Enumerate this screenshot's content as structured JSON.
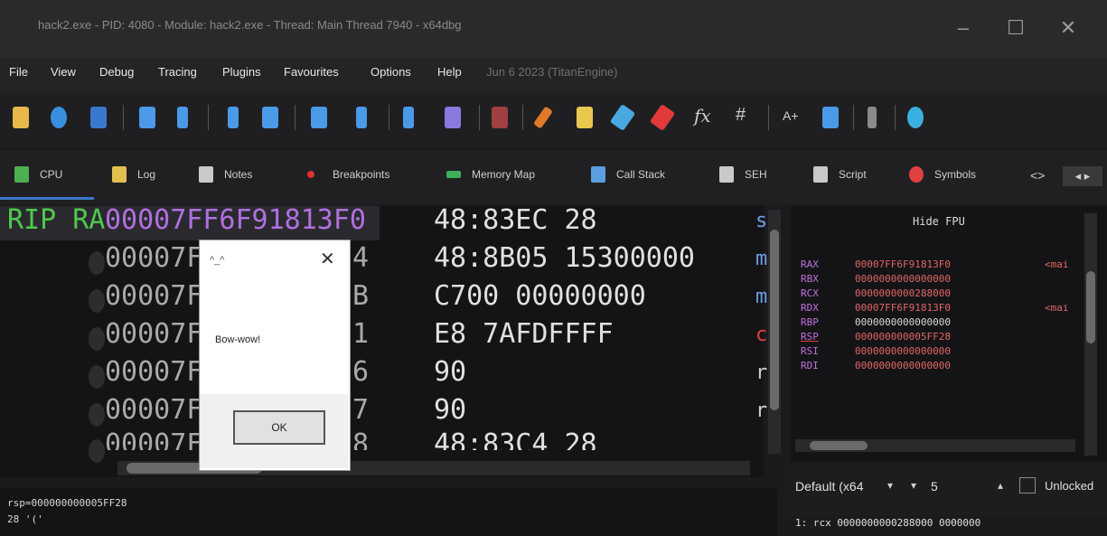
{
  "window": {
    "title": "hack2.exe - PID: 4080 - Module: hack2.exe - Thread: Main Thread 7940 - x64dbg",
    "controls": [
      "–",
      "☐",
      "✕"
    ]
  },
  "menu": {
    "items": [
      "File",
      "View",
      "Debug",
      "Tracing",
      "Plugins",
      "Favourites",
      "Options",
      "Help"
    ],
    "date": "Jun 6 2023 (TitanEngine)"
  },
  "tabs": [
    {
      "label": "CPU",
      "icon": "cpu-icon",
      "color": "#4caf50"
    },
    {
      "label": "Log",
      "icon": "log-icon",
      "color": "#e0c04a"
    },
    {
      "label": "Notes",
      "icon": "notes-icon",
      "color": "#c9c9c9"
    },
    {
      "label": "Breakpoints",
      "icon": "breakpoint-icon",
      "color": "#e03030"
    },
    {
      "label": "Memory Map",
      "icon": "memory-map-icon",
      "color": "#3fae5a"
    },
    {
      "label": "Call Stack",
      "icon": "call-stack-icon",
      "color": "#5a9ee0"
    },
    {
      "label": "SEH",
      "icon": "seh-icon",
      "color": "#c9c9c9"
    },
    {
      "label": "Script",
      "icon": "script-icon",
      "color": "#c9c9c9"
    },
    {
      "label": "Symbols",
      "icon": "symbols-icon",
      "color": "#e04040"
    }
  ],
  "disasm": {
    "rip_label": "RIP RA",
    "rows": [
      {
        "address": "00007FF6F91813F0",
        "addr_tail": "",
        "bytes": "48:83EC 28",
        "mnem": "s",
        "current": true
      },
      {
        "address": "00007F",
        "addr_tail": "4",
        "bytes": "48:8B05 15300000",
        "mnem": "m",
        "current": false
      },
      {
        "address": "00007F",
        "addr_tail": "B",
        "bytes": "C700 00000000",
        "mnem": "m",
        "current": false
      },
      {
        "address": "00007F",
        "addr_tail": "1",
        "bytes": "E8 7AFDFFFF",
        "mnem": "c",
        "current": false
      },
      {
        "address": "00007F",
        "addr_tail": "6",
        "bytes": "90",
        "mnem": "r",
        "current": false
      },
      {
        "address": "00007F",
        "addr_tail": "7",
        "bytes": "90",
        "mnem": "r",
        "current": false
      },
      {
        "address": "00007F",
        "addr_tail": "8",
        "bytes": "48:83C4 28",
        "mnem": "",
        "current": false
      }
    ]
  },
  "registers": {
    "hide_fpu": "Hide FPU",
    "rows": [
      {
        "name": "RAX",
        "value": "00007FF6F91813F0",
        "note": "<mai"
      },
      {
        "name": "RBX",
        "value": "0000000000000000",
        "note": ""
      },
      {
        "name": "RCX",
        "value": "0000000000288000",
        "note": ""
      },
      {
        "name": "RDX",
        "value": "00007FF6F91813F0",
        "note": "<mai"
      },
      {
        "name": "RBP",
        "value": "0000000000000000",
        "note": ""
      },
      {
        "name": "RSP",
        "value": "000000000005FF28",
        "note": ""
      },
      {
        "name": "RSI",
        "value": "0000000000000000",
        "note": ""
      },
      {
        "name": "RDI",
        "value": "0000000000000000",
        "note": ""
      }
    ]
  },
  "callconv": {
    "select": "Default (x64",
    "count": "5",
    "unlocked": "Unlocked",
    "row": "1: rcx 0000000000288000 0000000"
  },
  "info": {
    "line1": "rsp=000000000005FF28",
    "line2": "28 '('"
  },
  "dialog": {
    "title": "^_^",
    "message": "Bow-wow!",
    "ok": "OK"
  }
}
